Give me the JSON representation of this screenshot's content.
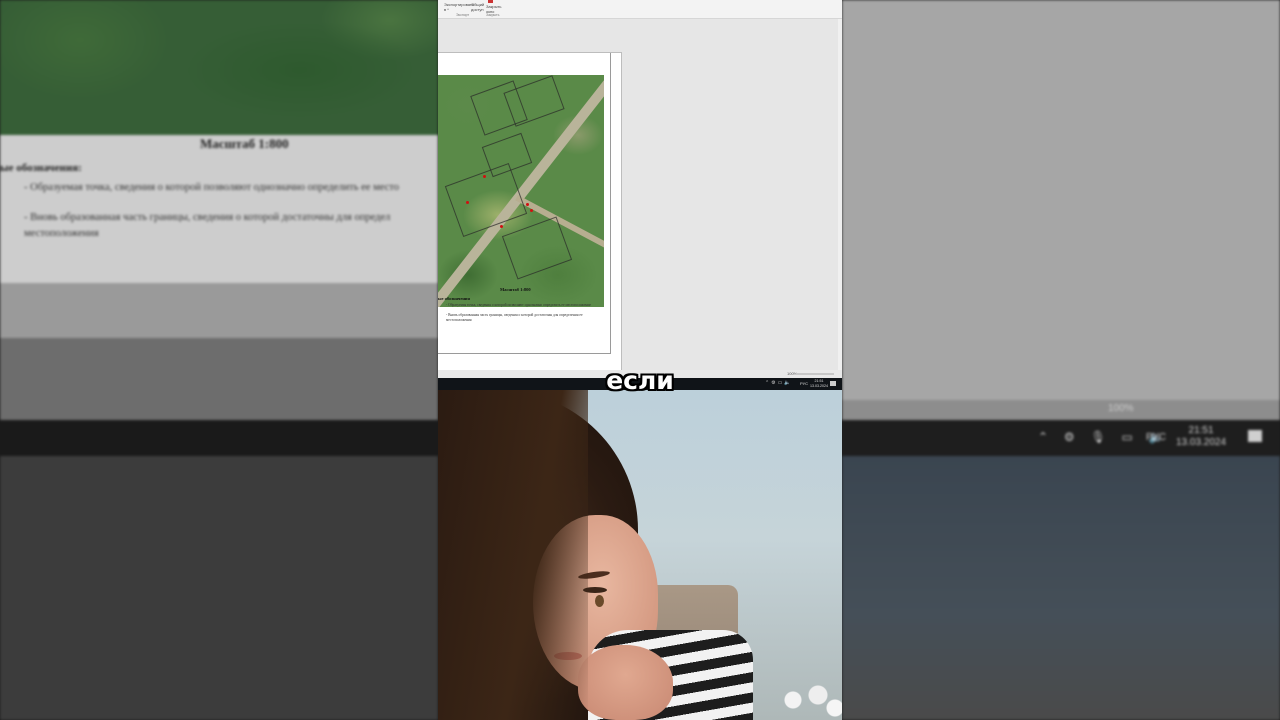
{
  "caption": "если",
  "document": {
    "scale": "Масштаб 1:800",
    "legend_title": "ые обозначения:",
    "legend_items": [
      "- Образуемая точка, сведения о которой позволяют однозначно определить ее место",
      "- Вновь образованная часть границы, сведения о которой достаточны для определ",
      "местоположения"
    ]
  },
  "page_preview": {
    "scale": "Масштаб 1:800",
    "legend_title": "ые обозначения",
    "legend_items": [
      "- Образуемая точка, сведения о которой позволяют однозначно определить ее местоположение",
      "- Вновь образованная часть границы, сведения о которой достаточны для определения ее",
      "местоположения"
    ]
  },
  "ribbon": {
    "btn_copy": "Экспортировать в *",
    "btn_paste": "Общий доступ",
    "btn_red": "Закрыть окно",
    "group_1": "Экспорт",
    "group_2": "Закрыть"
  },
  "status": {
    "zoom": "100%"
  },
  "taskbar": {
    "lang": "РУС",
    "time": "21:51",
    "date": "13.03.2024"
  },
  "colors": {
    "ribbon_bg": "#f3f3f3",
    "canvas_bg": "#e6e6e6",
    "taskbar_bg": "#101418",
    "caption_text": "#ffffff"
  }
}
